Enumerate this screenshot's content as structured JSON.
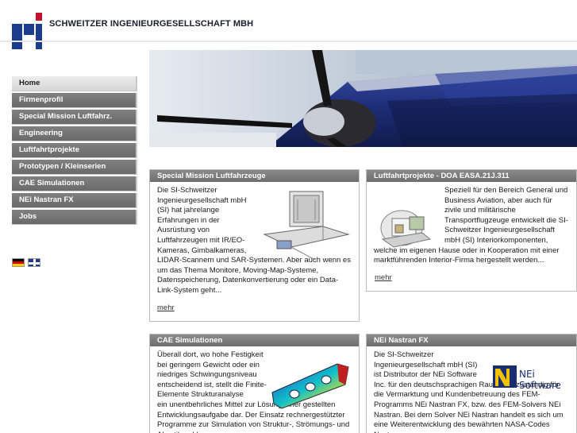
{
  "header": {
    "company_name": "SCHWEITZER INGENIEURGESELLSCHAFT MBH"
  },
  "nav": {
    "items": [
      {
        "label": "Home",
        "active": true
      },
      {
        "label": "Firmenprofil"
      },
      {
        "label": "Special Mission Luftfahrz."
      },
      {
        "label": "Engineering"
      },
      {
        "label": "Luftfahrtprojekte"
      },
      {
        "label": "Prototypen / Kleinserien"
      },
      {
        "label": "CAE Simulationen"
      },
      {
        "label": "NEi Nastran FX"
      },
      {
        "label": "Jobs"
      }
    ]
  },
  "languages": [
    {
      "icon": "german-flag-icon"
    },
    {
      "icon": "uk-flag-icon"
    }
  ],
  "boxes": {
    "special_mission": {
      "title": "Special Mission Luftfahrzeuge",
      "text_indented": "Die SI-Schweitzer Ingenieurgesellschaft mbH (SI) hat jahrelange Erfahrungen in der Ausrüstung von Luftfahrzeugen mit IR/EO-Kameras, Gimbalkameras,",
      "text_full": "LIDAR-Scannern und SAR-Systemen. Aber auch wenn es um das Thema Monitore, Moving-Map-Systeme, Datenspeicherung, Datenkonvertierung oder ein Data-Link-System geht...",
      "more": "mehr"
    },
    "luftfahrtprojekte": {
      "title": "Luftfahrtprojekte - DOA EASA.21J.311",
      "text_indented": "Speziell für den Bereich General und Business Aviation, aber auch für zivile und militärische Transportflugzeuge entwickelt die SI-Schweitzer Ingenieurgesellschaft mbH (SI) Interiorkomponenten,",
      "text_full": "welche im eigenen Hause oder in Kooperation mit einer marktführenden Interior-Firma hergestellt werden...",
      "more": "mehr"
    },
    "cae": {
      "title": "CAE Simulationen",
      "text_indented": "Überall dort, wo hohe Festigkeit bei geringem Gewicht oder ein niedriges Schwingungsniveau entscheidend ist, stellt die Finite-Elemente Strukturanalyse",
      "text_full": "ein unentbehrliches Mittel zur Lösung einer gestellten Entwicklungsaufgabe dar. Der Einsatz rechnergestützter Programme zur Simulation von Struktur-, Strömungs- und Akustikproblemen"
    },
    "nastran": {
      "title": "NEi Nastran FX",
      "text_indented": "Die SI-Schweitzer Ingenieurgesellschaft mbH (SI) ist Distributor der NEi Software",
      "text_full": "Inc. für den deutschsprachigen Raum und zuständig für die Vermarktung und Kundenbetreuung des FEM-Programms NEi Nastran FX, bzw. des FEM-Solvers NEi Nastran. Bei dem Solver NEi Nastran handelt es sich um eine Weiterentwicklung des bewährten NASA-Codes Nastran.",
      "logo_text_nei": "NEi",
      "logo_text_software": "Software"
    }
  },
  "colors": {
    "nav_bg": "#757575",
    "nav_active_bg": "#e2e2e2",
    "box_head_bg": "#7c7c7c",
    "logo_blue": "#1c3d8c",
    "logo_red": "#c8102e"
  }
}
